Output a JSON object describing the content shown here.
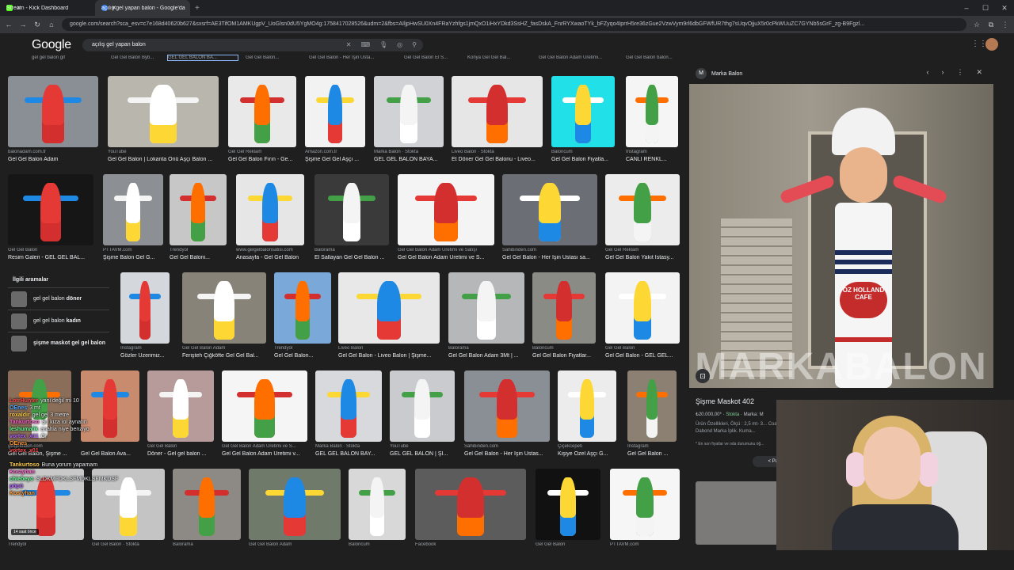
{
  "browser": {
    "tabs": [
      {
        "title": "Stream - Kick Dashboard",
        "color": "#53fc18"
      },
      {
        "title": "açılış gel yapan balon - Google'da",
        "color": "#4285f4"
      }
    ],
    "new_tab": "+",
    "url": "google.com/search?sca_esv=c7e168d40620b627&sxsrf=AE3TifOM1AMKUgpV_UoGlsn0dU5YgMO4g:1758417028526&udm=2&fbs=AIljpHwSU0Xn4FRaYzhfgs1jmQxO1iHxYDkd3SsHZ_fasDskA_FnrRYXwaoTYk_bFZyqo4IprrH5re36zGue2VzwVym9rl6dbGFWfUR7thg7sUqvOjjuX5r0cPkWUuZC7GYNb5sGrF_zg-B9Fgzl..."
  },
  "google": {
    "logo": "Google",
    "query": "açılış gel yapan balon"
  },
  "top_strip": [
    "gel gel balon gif",
    "Gel Gel Balon Byb...",
    "GEL GEL BALON BA...",
    "Gel Gel Balon...",
    "Gel Gel Balon - Her İşin Usta...",
    "Gel Gel Balon El S...",
    "Konya Gel Gel Bal...",
    "Gel Gel Balon Adam Üretimi...",
    "Gel Gel Balon balon..."
  ],
  "results": [
    {
      "src": "balonadam.com.tr",
      "title": "Gel Gel Balon Adam",
      "color": "#8a8f96"
    },
    {
      "src": "YouTube",
      "title": "Gel Gel Balon | Lokanta Önü Aşçı Balon ...",
      "color": "#b9b6ad"
    },
    {
      "src": "Gel Gel Reklam",
      "title": "Gel Gel Balon Fırın - Ge...",
      "color": "#e9e9e9"
    },
    {
      "src": "Amazon.com.tr",
      "title": "Şişme Gel Gel Aşçı ...",
      "color": "#f2f2f2"
    },
    {
      "src": "Marka Balon · Stokta",
      "title": "GEL GEL BALON BAYA...",
      "color": "#d0d2d6"
    },
    {
      "src": "Liveo Balon · Stokta",
      "title": "Et Döner Gel Gel Balonu - Liveo...",
      "color": "#e6e6e6"
    },
    {
      "src": "Baloncum",
      "title": "Gel Gel Balon Fiyatla...",
      "color": "#22e0e8"
    },
    {
      "src": "Instagram",
      "title": "CANLI RENKL...",
      "color": "#f5f5f5"
    },
    {
      "src": "Gel Gel Balon",
      "title": "Resim Galeri - GEL GEL BAL...",
      "color": "#161616"
    },
    {
      "src": "PTTAVM.com",
      "title": "Şişme Balon Gel G...",
      "color": "#8c8f94"
    },
    {
      "src": "Trendyol",
      "title": "Gel Gel Baloni...",
      "color": "#c7c7c7"
    },
    {
      "src": "www.gelgelbalonsatisi.com",
      "title": "Anasayfa - Gel Gel Balon",
      "color": "#e6e6e6"
    },
    {
      "src": "Balorama",
      "title": "El Sallayan Gel Gel Balon ...",
      "color": "#3a3a3a"
    },
    {
      "src": "Gel Gel Balon Adam Üretimi ve Satışı",
      "title": "Gel Gel Balon Adam Üretimi ve S...",
      "color": "#f4f4f4"
    },
    {
      "src": "Sahibinden.com",
      "title": "Gel Gel Balon - Her İşin Ustası sa...",
      "color": "#6b6f75"
    },
    {
      "src": "Gel Gel Reklam",
      "title": "Gel Gel Balon Yakıt İstasy...",
      "color": "#ececec"
    },
    {
      "src": "Instagram",
      "title": "Gözler Üzerimiz...",
      "color": "#d4d7dc"
    },
    {
      "src": "Gel Gel Balon Adam",
      "title": "Ferişteh Çiğköfte Gel Gel Bal...",
      "color": "#878378"
    },
    {
      "src": "Trendyol",
      "title": "Gel Gel Balon...",
      "color": "#7aa8d8"
    },
    {
      "src": "Liveo Balon",
      "title": "Gel Gel Balon - Liveo Balon | Şişme...",
      "color": "#e8e8e8"
    },
    {
      "src": "Balorama",
      "title": "Gel Gel Balon Adam 3Mt | ...",
      "color": "#b5b7b9"
    },
    {
      "src": "Baloncum",
      "title": "Gel Gel Balon Fiyatlar...",
      "color": "#8a8b84"
    },
    {
      "src": "Gel Gel Balon",
      "title": "Gel Gel Balon - GEL GEL...",
      "color": "#f3f3f3"
    },
    {
      "src": "gelgelbalon.com",
      "title": "Gel Gel Balon, Şişme ...",
      "color": "#8a6e5a"
    },
    {
      "src": "",
      "title": "Gel Gel Balon Ava...",
      "color": "#c98b6e"
    },
    {
      "src": "Gel Gel Balon",
      "title": "Döner - Gel gel balon ...",
      "color": "#b79a9a"
    },
    {
      "src": "Gel Gel Balon Adam Üretimi ve S...",
      "title": "Gel Gel Balon Adam Üretimi v...",
      "color": "#f5f5f5"
    },
    {
      "src": "Marka Balon · Stokta",
      "title": "GEL GEL BALON BAY...",
      "color": "#d7d9dc"
    },
    {
      "src": "YouTube",
      "title": "GEL GEL BALON | Şİ...",
      "color": "#c9cbcf"
    },
    {
      "src": "Sahibinden.com",
      "title": "Gel Gel Balon - Her İşin Ustas...",
      "color": "#8a8f96"
    },
    {
      "src": "Çiçekcepeti",
      "title": "Kişiye Özel Aşçı G...",
      "color": "#ececec"
    },
    {
      "src": "Instagram",
      "title": "Gel Gel Balon ...",
      "color": "#8c8073"
    },
    {
      "src": "Trendyol",
      "title": "",
      "color": "#c9c9c9"
    },
    {
      "src": "Gel Gel Balon · Stokta",
      "title": "",
      "color": "#c4c4c4"
    },
    {
      "src": "Balorama",
      "title": "",
      "color": "#8d8a86"
    },
    {
      "src": "Gel Gel Balon Adam",
      "title": "",
      "color": "#6f7a6a"
    },
    {
      "src": "Baloncum",
      "title": "",
      "color": "#d8d8d8"
    },
    {
      "src": "Facebook",
      "title": "",
      "color": "#5c5c5c"
    },
    {
      "src": "Gel Gel Balon",
      "title": "",
      "color": "#111111"
    },
    {
      "src": "PTTAVM.com",
      "title": "",
      "color": "#f6f6f6"
    }
  ],
  "related": {
    "heading": "İlgili aramalar",
    "items": [
      {
        "prefix": "gel gel balon ",
        "bold": "döner"
      },
      {
        "prefix": "gel gel balon ",
        "bold": "kadın"
      },
      {
        "prefix": "",
        "bold": "şişme maskot gel gel balon"
      }
    ]
  },
  "panel": {
    "source": "Marka Balon",
    "source_initial": "M",
    "watermark": "MARKABALON",
    "badge_text": "OZ HOLLAND CAFE",
    "title": "Şişme Maskot 402",
    "price": "₺20.000,00*",
    "stock": "Stokta",
    "brand_partial": "Marka: M",
    "desc": "Ürün Özellikleri, Ölçü : 2,5 mt- 3... Coats Dabond Marka İplik. Kuma...",
    "note": "* En son fiyatlar ve oda durumunu öğ...",
    "share": "Payl"
  },
  "chat": {
    "messages": [
      {
        "user": "LotrHunter",
        "text": "yani değil mi 10"
      },
      {
        "user": "OEnes",
        "text": "3 mt"
      },
      {
        "user": "roxaldir",
        "text": "gel gel 3 metre"
      },
      {
        "user": "Tankurtoso",
        "text": "Şu kıza iol aynatın"
      },
      {
        "user": "leshumalik",
        "text": "analtia niye benziyo"
      },
      {
        "user": "vortex_x01",
        "text": "Gi"
      },
      {
        "user": "OEnes",
        "text": ""
      },
      {
        "user": "vortex_x01",
        "text": ""
      },
      {
        "user": "",
        "text": ""
      },
      {
        "user": "Tankurtoso",
        "text": "Buna yorum yapamam"
      },
      {
        "user": "Kostyhan",
        "text": ""
      },
      {
        "user": "chiebeyo",
        "text": "SLDKMFDKLSFMDKLSFMKDSF"
      },
      {
        "user": "pöpü",
        "text": ""
      },
      {
        "user": "Kostyhan",
        "text": ""
      }
    ],
    "time_badge": "14 saat önce"
  }
}
